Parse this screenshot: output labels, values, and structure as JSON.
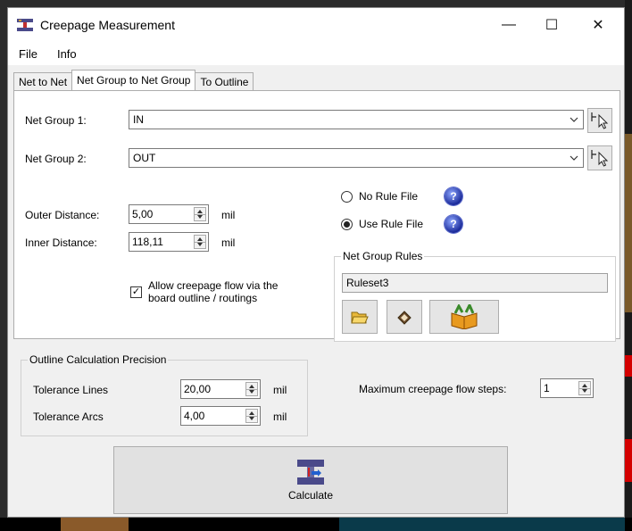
{
  "window": {
    "title": "Creepage Measurement",
    "controls": {
      "minimize": "—",
      "maximize": "☐",
      "close": "✕"
    }
  },
  "menu": {
    "items": [
      "File",
      "Info"
    ]
  },
  "tabs": [
    {
      "label": "Net to Net",
      "active": false
    },
    {
      "label": "Net Group to Net Group",
      "active": true
    },
    {
      "label": "To Outline",
      "active": false
    }
  ],
  "net_groups": {
    "group1_label": "Net Group 1:",
    "group1_value": "IN",
    "group2_label": "Net Group 2:",
    "group2_value": "OUT"
  },
  "distances": {
    "outer_label": "Outer Distance:",
    "outer_value": "5,00",
    "outer_unit": "mil",
    "inner_label": "Inner Distance:",
    "inner_value": "118,11",
    "inner_unit": "mil"
  },
  "allow_flow": {
    "line1": "Allow creepage flow via the",
    "line2": "board outline / routings",
    "checked": true
  },
  "rule_file": {
    "no_rule_label": "No Rule File",
    "use_rule_label": "Use Rule File",
    "selected": "use",
    "help_icon": "help-question-icon"
  },
  "net_group_rules": {
    "title": "Net Group Rules",
    "ruleset": "Ruleset3",
    "buttons": [
      "open-folder-icon",
      "erase-icon",
      "package-icon"
    ]
  },
  "outline_precision": {
    "title": "Outline Calculation Precision",
    "tol_lines_label": "Tolerance Lines",
    "tol_lines_value": "20,00",
    "tol_lines_unit": "mil",
    "tol_arcs_label": "Tolerance Arcs",
    "tol_arcs_value": "4,00",
    "tol_arcs_unit": "mil"
  },
  "max_steps": {
    "label": "Maximum creepage flow steps:",
    "value": "1"
  },
  "calculate": {
    "label": "Calculate"
  }
}
